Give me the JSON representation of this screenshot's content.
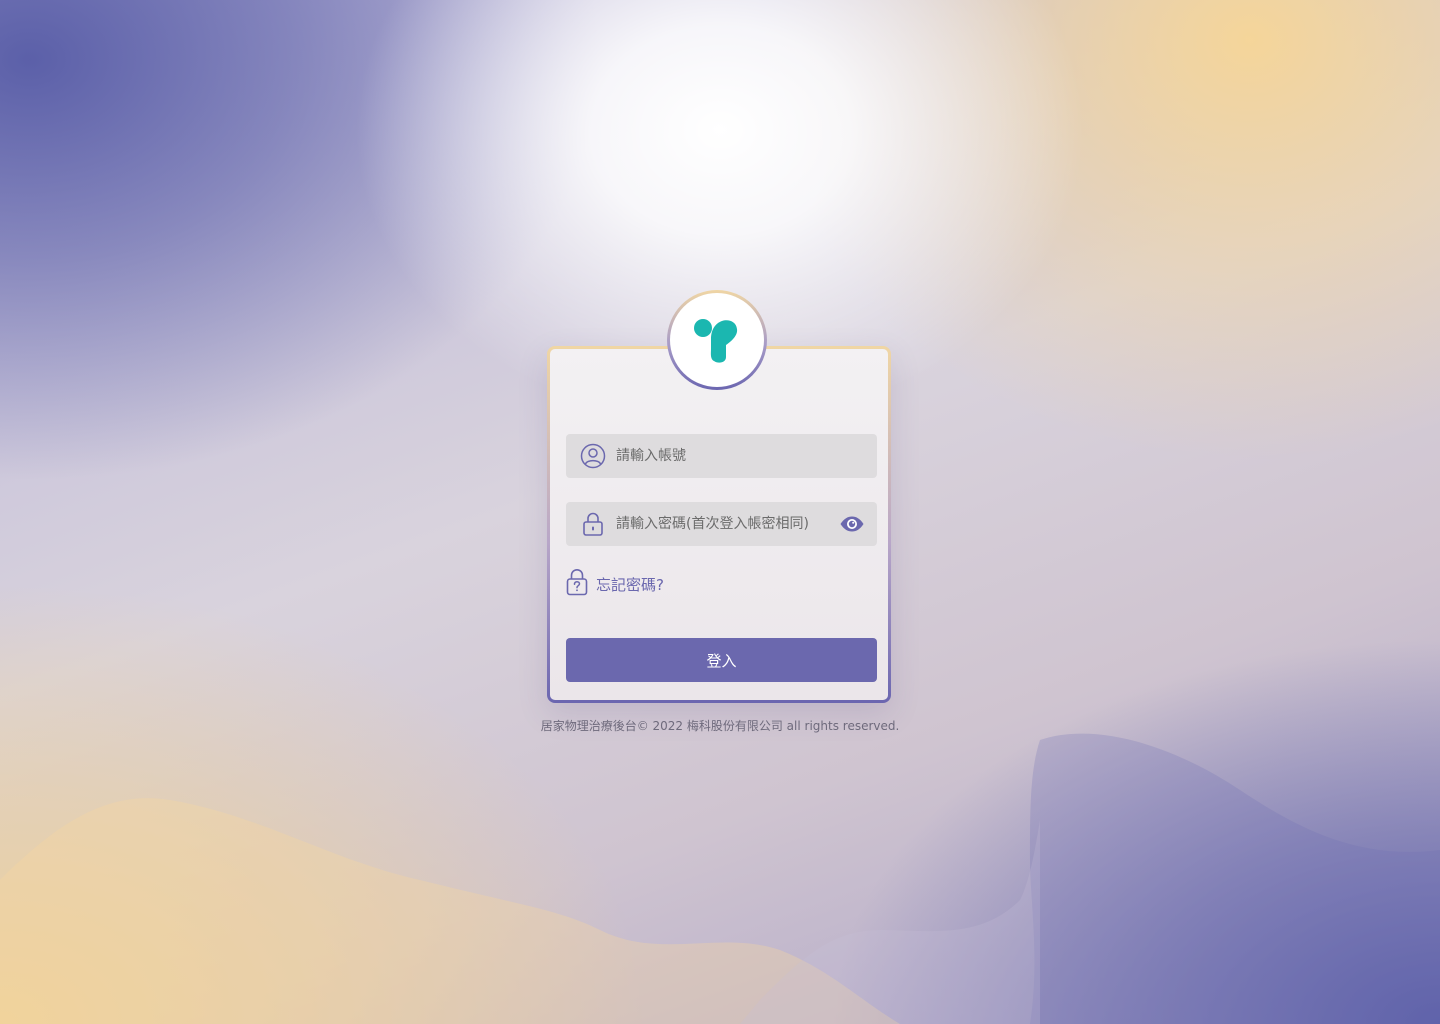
{
  "brand": {
    "logo_icon": "teal-y-logo-icon",
    "logo_color": "#1bb7b0"
  },
  "login_form": {
    "account_placeholder": "請輸入帳號",
    "account_icon": "user-circle-icon",
    "password_placeholder": "請輸入密碼(首次登入帳密相同)",
    "password_icon": "lock-icon",
    "show_password_icon": "eye-icon",
    "forgot_password_label": "忘記密碼?",
    "forgot_password_icon": "lock-question-icon",
    "login_button_label": "登入"
  },
  "footer": {
    "copyright": "居家物理治療後台© 2022 梅科股份有限公司 all rights reserved."
  },
  "colors": {
    "accent": "#6b68ae",
    "field_bg": "#dedcde",
    "brand_teal": "#1bb7b0"
  }
}
